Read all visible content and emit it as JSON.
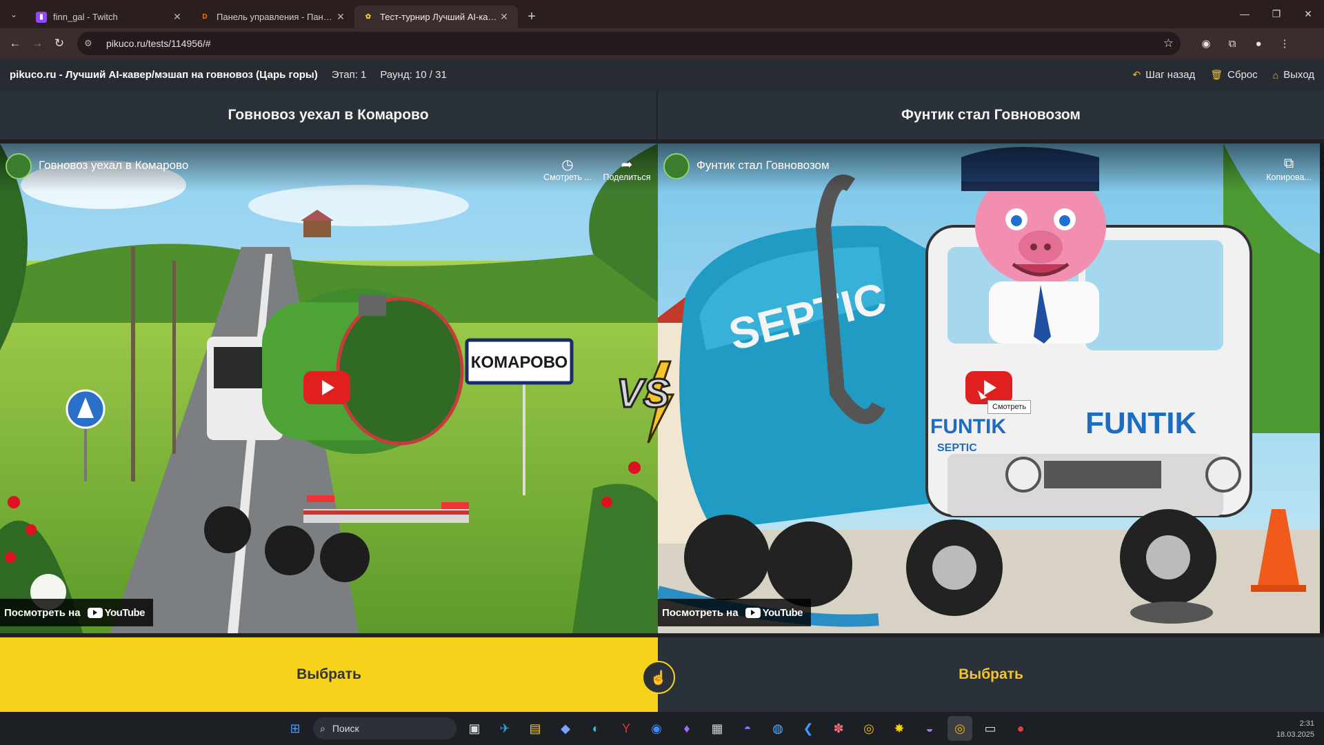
{
  "browser": {
    "tabs": [
      {
        "title": "finn_gal - Twitch",
        "favicon": "twitch-icon",
        "color": "#9146ff",
        "active": false
      },
      {
        "title": "Панель управления - Панель",
        "favicon": "donation-alerts-icon",
        "color": "#f57d07",
        "active": false
      },
      {
        "title": "Тест-турнир Лучший AI-кавер/",
        "favicon": "pikuco-icon",
        "color": "#f6d21a",
        "active": true
      }
    ],
    "url": "pikuco.ru/tests/114956/#"
  },
  "site": {
    "brand": "pikuco.ru - Лучший AI-кавер/мэшап на говновоз (Царь горы)",
    "stage": "Этап: 1",
    "round": "Раунд: 10 / 31",
    "actions": {
      "back": "Шаг назад",
      "reset": "Сброс",
      "exit": "Выход"
    },
    "accent": "#f6d21a"
  },
  "matchup": {
    "left": {
      "title": "Говновоз уехал в Комарово",
      "video_title": "Говновоз уехал в Комарово",
      "watch_later": "Смотреть ...",
      "share": "Поделиться",
      "sign_text": "КОМАРОВО",
      "watch_on": "Посмотреть на",
      "youtube": "YouTube",
      "choose": "Выбрать"
    },
    "right": {
      "title": "Фунтик стал Говновозом",
      "video_title": "Фунтик стал Говновозом",
      "copy": "Копирова...",
      "tooltip": "Смотреть",
      "tank_text": "SEPTIC",
      "cab_text": "FUNTIK",
      "door_text1": "FUNTIK",
      "door_text2": "SEPTIC",
      "watch_on": "Посмотреть на",
      "youtube": "YouTube",
      "choose": "Выбрать"
    },
    "vs_text": "VS"
  },
  "taskbar": {
    "search_placeholder": "Поиск",
    "time": "2:31",
    "date": "18.03.2025"
  }
}
